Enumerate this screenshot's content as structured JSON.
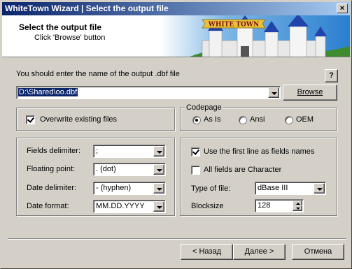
{
  "window": {
    "title": "WhiteTown Wizard | Select the output file"
  },
  "header": {
    "title": "Select the output file",
    "subtitle": "Click 'Browse' button",
    "logo_text": "WHITE TOWN"
  },
  "output": {
    "label": "You should enter the name of the output .dbf file",
    "path_value": "D:\\Shared\\oo.dbf",
    "browse_label": "Browse",
    "help_label": "?"
  },
  "options": {
    "overwrite_label": "Overwrite existing files",
    "overwrite_checked": true
  },
  "codepage": {
    "title": "Codepage",
    "options": [
      {
        "label": "As Is",
        "checked": true
      },
      {
        "label": "Ansi",
        "checked": false
      },
      {
        "label": "OEM",
        "checked": false
      }
    ]
  },
  "fields": {
    "fields_delimiter_label": "Fields delimiter:",
    "fields_delimiter_value": ";",
    "floating_point_label": "Floating point:",
    "floating_point_value": ". (dot)",
    "date_delimiter_label": "Date delimiter:",
    "date_delimiter_value": "- (hyphen)",
    "date_format_label": "Date format:",
    "date_format_value": "MM.DD.YYYY"
  },
  "file_options": {
    "first_line_label": "Use the first line as fields names",
    "first_line_checked": true,
    "all_char_label": "All fields are Character",
    "all_char_checked": false,
    "type_label": "Type of file:",
    "type_value": "dBase III",
    "blocksize_label": "Blocksize",
    "blocksize_value": "128"
  },
  "footer": {
    "back_label": "< Назад",
    "next_label": "Далее >",
    "cancel_label": "Отмена"
  },
  "colors": {
    "title_start": "#0a246a",
    "title_end": "#a6caf0",
    "selection": "#0a246a",
    "face": "#d4d0c8"
  }
}
